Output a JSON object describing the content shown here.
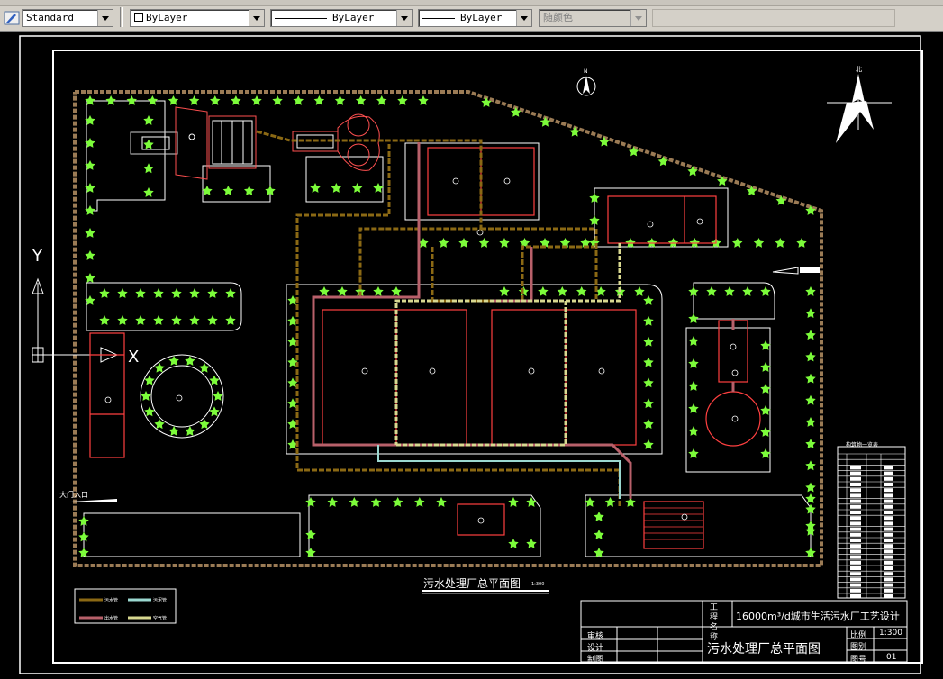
{
  "toolbar": {
    "text_style": "Standard",
    "layer": "ByLayer",
    "linetype": "ByLayer",
    "lineweight": "ByLayer",
    "plot_style": "随颜色"
  },
  "drawing": {
    "plan_title": "污水处理厂总平面图",
    "plan_scale": "1:300",
    "gate_label": "大门入口",
    "ucs_y": "Y",
    "ucs_x": "X",
    "north_label": "北"
  },
  "legend": [
    {
      "label": "污水管",
      "color": "#8B6914"
    },
    {
      "label": "污泥管",
      "color": "#9BD8D0"
    },
    {
      "label": "出水管",
      "color": "#B8606A"
    },
    {
      "label": "空气管",
      "color": "#D8D890"
    }
  ],
  "title_block": {
    "project_label": "工程名称",
    "project_name": "16000m³/d城市生活污水厂工艺设计",
    "drawing_name": "污水处理厂总平面图",
    "review_label": "审核",
    "design_label": "设计",
    "draw_label": "制图",
    "scale_label": "比例",
    "scale_value": "1:300",
    "sheet_label": "图别",
    "sheet_value": "",
    "number_label": "图号",
    "number_value": "01"
  },
  "table_title": "构筑物一览表"
}
